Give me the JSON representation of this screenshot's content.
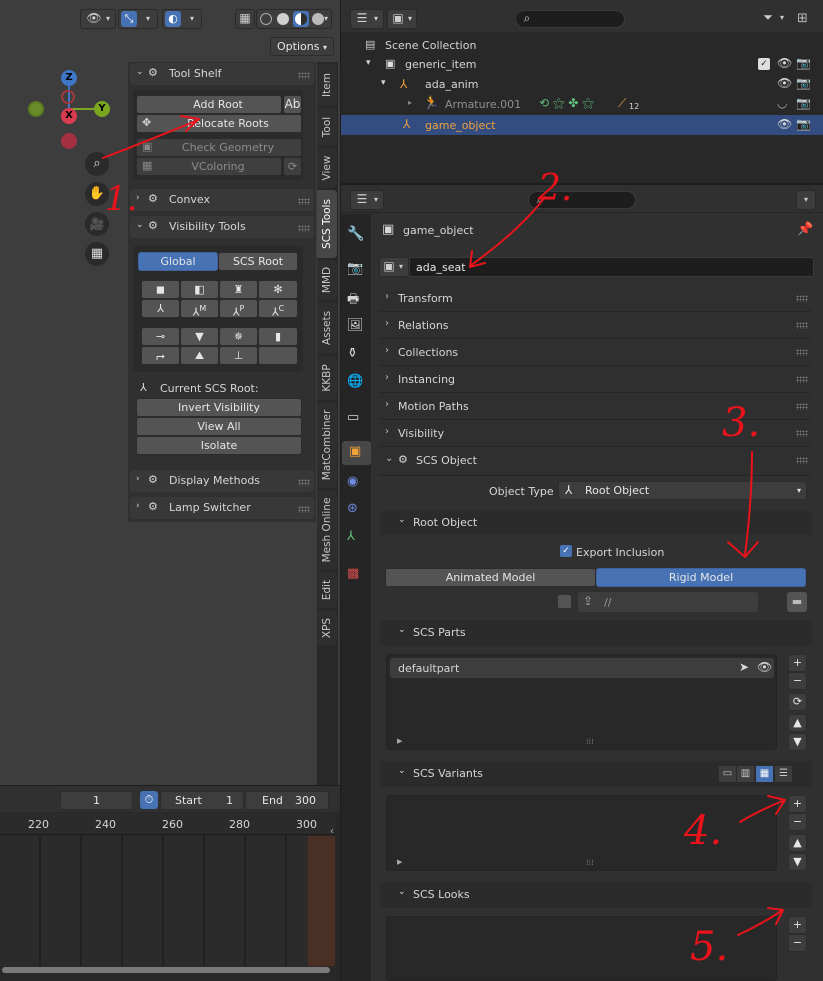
{
  "viewport": {
    "options_label": "Options",
    "axes": {
      "z": "Z",
      "y": "Y",
      "x": "X"
    },
    "tool_icons": [
      "zoom-icon",
      "pan-hand-icon",
      "camera-icon",
      "grid-icon"
    ]
  },
  "side_tabs": [
    "Item",
    "Tool",
    "View",
    "SCS Tools",
    "MMD",
    "Assets",
    "KKBP",
    "MatCombiner",
    "Mesh Online",
    "Edit",
    "XPS"
  ],
  "tool_shelf": {
    "title": "Tool Shelf",
    "add_root": "Add Root",
    "ab_icon": "Ab",
    "relocate_roots": "Relocate Roots",
    "check_geometry": "Check Geometry",
    "vcoloring": "VColoring",
    "convex": "Convex",
    "visibility_tools": "Visibility Tools",
    "global": "Global",
    "scs_root": "SCS Root",
    "current_scs_root": "Current SCS Root:",
    "invert_visibility": "Invert Visibility",
    "view_all": "View All",
    "isolate": "Isolate",
    "display_methods": "Display Methods",
    "lamp_switcher": "Lamp Switcher",
    "grid_sublabels": [
      "M",
      "P",
      "C"
    ]
  },
  "timeline": {
    "current_frame": "1",
    "start_label": "Start",
    "start_value": "1",
    "end_label": "End",
    "end_value": "300",
    "ruler": [
      "220",
      "240",
      "260",
      "280",
      "300"
    ]
  },
  "outliner": {
    "scene_collection": "Scene Collection",
    "items": [
      {
        "label": "generic_item"
      },
      {
        "label": "ada_anim"
      },
      {
        "label": "Armature.001",
        "badge": "12"
      },
      {
        "label": "game_object"
      }
    ]
  },
  "properties": {
    "object_name": "game_object",
    "data_name": "ada_seat",
    "panels": [
      "Transform",
      "Relations",
      "Collections",
      "Instancing",
      "Motion Paths",
      "Visibility"
    ],
    "scs_object": "SCS Object",
    "object_type_label": "Object Type",
    "object_type_value": "Root Object",
    "root_object": "Root Object",
    "export_inclusion": "Export Inclusion",
    "animated_model": "Animated Model",
    "rigid_model": "Rigid Model",
    "path_value": "//",
    "scs_parts": "SCS Parts",
    "default_part": "defaultpart",
    "scs_variants": "SCS Variants",
    "scs_looks": "SCS Looks"
  },
  "annotations": [
    "1.",
    "2.",
    "3.",
    "4.",
    "5."
  ],
  "colors": {
    "accent": "#4772b3",
    "active_text": "#f0a33a",
    "annotation": "#e8131b"
  }
}
